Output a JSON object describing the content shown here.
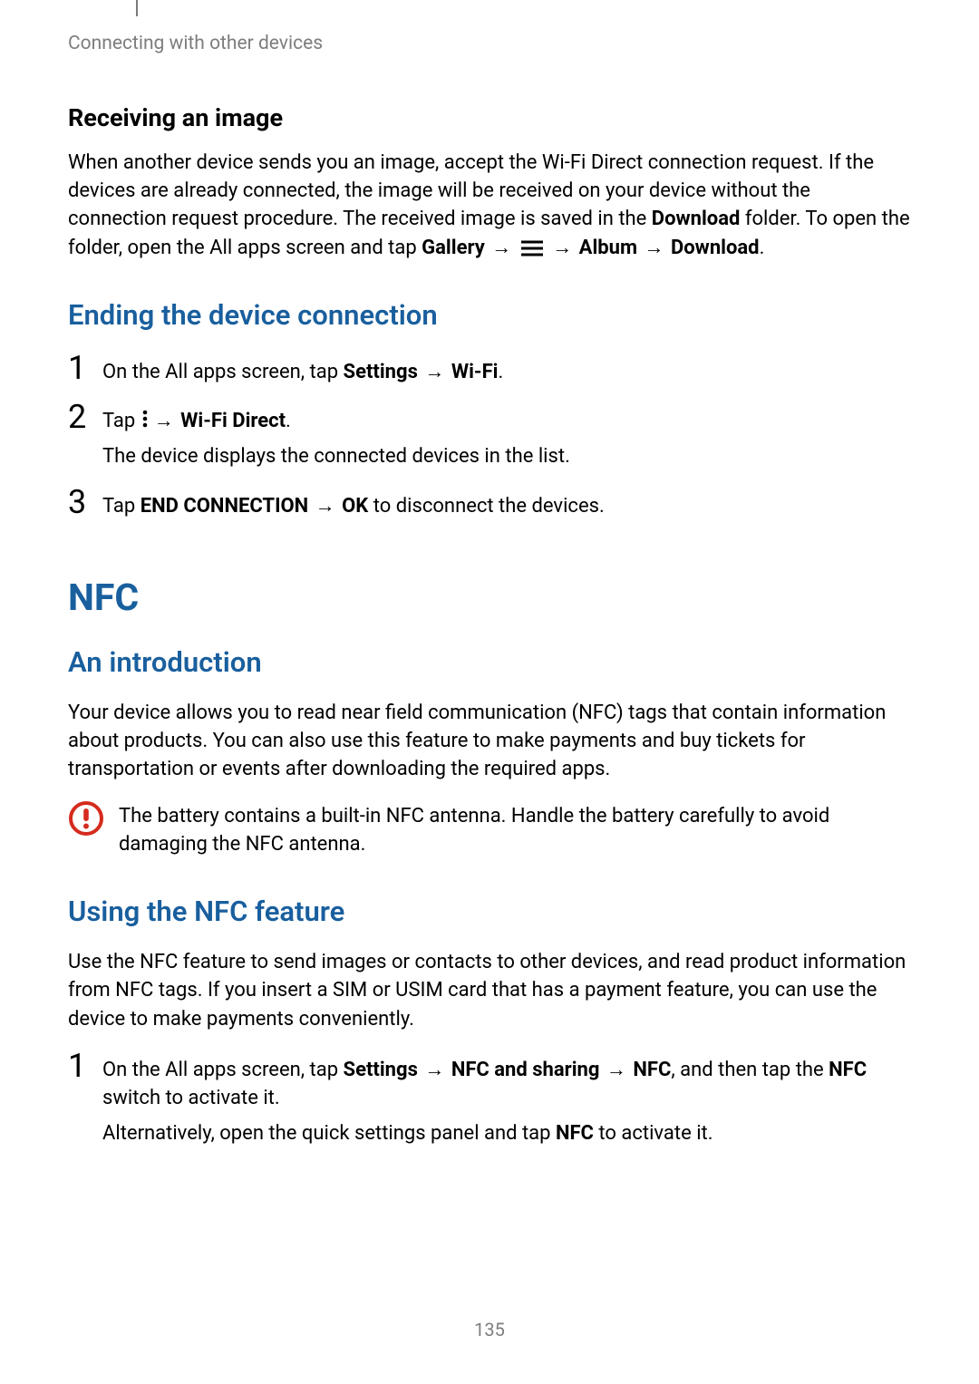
{
  "header": "Connecting with other devices",
  "sec1": {
    "title": "Receiving an image",
    "p_a": "When another device sends you an image, accept the Wi-Fi Direct connection request. If the devices are already connected, the image will be received on your device without the connection request procedure. The received image is saved in the ",
    "download": "Download",
    "p_b": " folder. To open the folder, open the All apps screen and tap ",
    "gallery": "Gallery",
    "album": "Album",
    "download2": "Download",
    "arrow": "→",
    "period": "."
  },
  "sec2": {
    "title": "Ending the device connection",
    "s1_a": "On the All apps screen, tap ",
    "s1_settings": "Settings",
    "s1_wifi": "Wi-Fi",
    "s2_a": "Tap ",
    "s2_wdf": "Wi-Fi Direct",
    "s2_sub": "The device displays the connected devices in the list.",
    "s3_a": "Tap ",
    "s3_end": "END CONNECTION",
    "s3_ok": "OK",
    "s3_b": " to disconnect the devices.",
    "arrow": "→",
    "period": "."
  },
  "sec3": {
    "title": "NFC"
  },
  "sec4": {
    "title": "An introduction",
    "p1": "Your device allows you to read near field communication (NFC) tags that contain information about products. You can also use this feature to make payments and buy tickets for transportation or events after downloading the required apps.",
    "note": "The battery contains a built-in NFC antenna. Handle the battery carefully to avoid damaging the NFC antenna."
  },
  "sec5": {
    "title": "Using the NFC feature",
    "p1": "Use the NFC feature to send images or contacts to other devices, and read product information from NFC tags. If you insert a SIM or USIM card that has a payment feature, you can use the device to make payments conveniently.",
    "s1_a": "On the All apps screen, tap ",
    "s1_settings": "Settings",
    "s1_nfcshare": "NFC and sharing",
    "s1_nfc": "NFC",
    "s1_b": ", and then tap the ",
    "s1_nfc2": "NFC",
    "s1_c": " switch to activate it.",
    "s1_sub_a": "Alternatively, open the quick settings panel and tap ",
    "s1_sub_nfc": "NFC",
    "s1_sub_b": " to activate it.",
    "arrow": "→"
  },
  "nums": {
    "one": "1",
    "two": "2",
    "three": "3"
  },
  "pageNumber": "135"
}
